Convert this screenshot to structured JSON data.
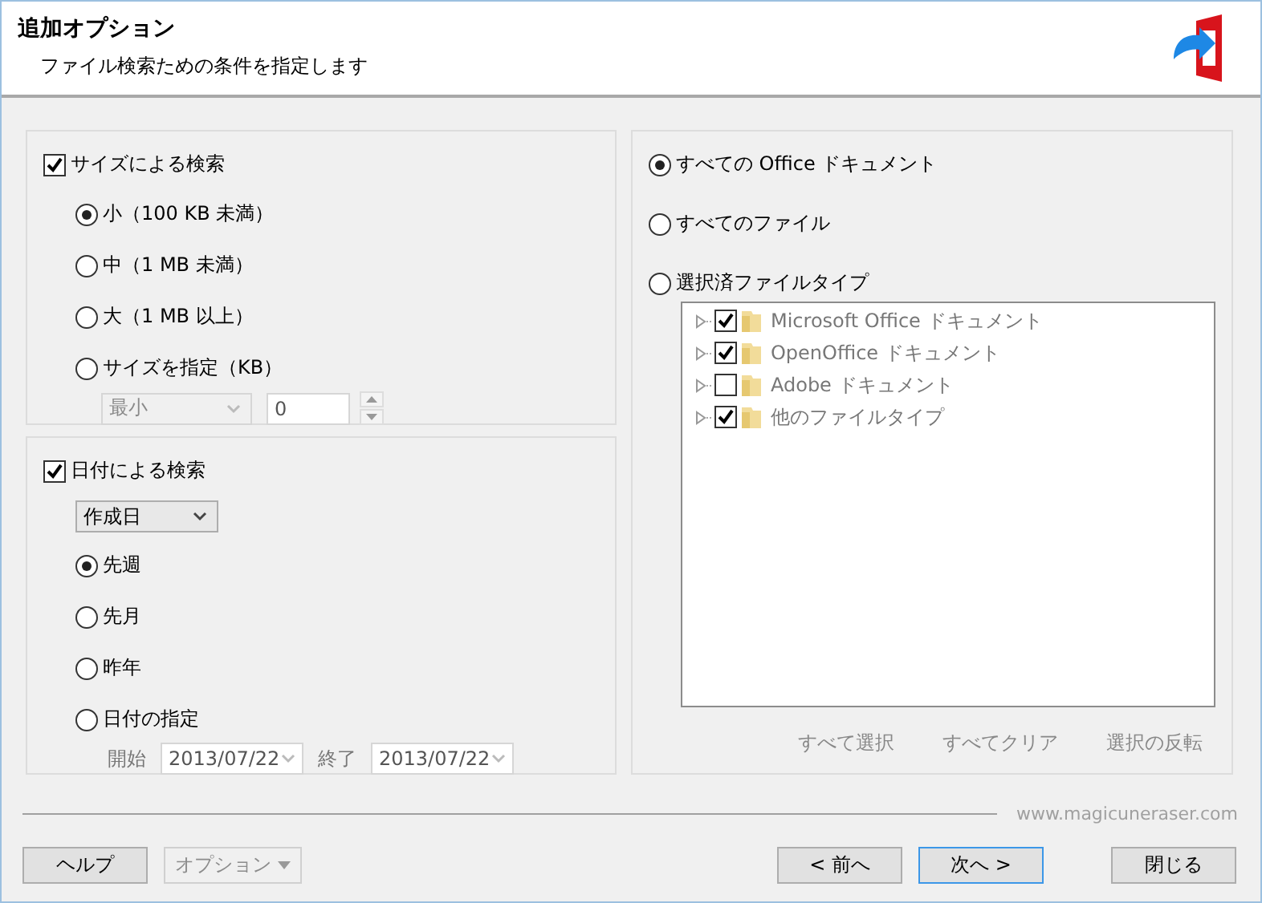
{
  "header": {
    "title": "追加オプション",
    "subtitle": "ファイル検索ための条件を指定します"
  },
  "size_group": {
    "label": "サイズによる検索",
    "checked": true,
    "options": [
      {
        "label": "小（100 KB 未満）",
        "selected": true
      },
      {
        "label": "中（1 MB 未満）",
        "selected": false
      },
      {
        "label": "大（1 MB 以上）",
        "selected": false
      },
      {
        "label": "サイズを指定（KB）",
        "selected": false
      }
    ],
    "min_select": {
      "value": "最小",
      "disabled": true
    },
    "size_input": {
      "value": "0",
      "disabled": true
    }
  },
  "date_group": {
    "label": "日付による検索",
    "checked": true,
    "date_type": "作成日",
    "options": [
      {
        "label": "先週",
        "selected": true
      },
      {
        "label": "先月",
        "selected": false
      },
      {
        "label": "昨年",
        "selected": false
      },
      {
        "label": "日付の指定",
        "selected": false
      }
    ],
    "range_disabled": true,
    "from_label": "開始",
    "from": "2013/07/22",
    "to_label": "終了",
    "to": "2013/07/22"
  },
  "file_types": {
    "options": [
      {
        "label": "すべての Office ドキュメント",
        "selected": true
      },
      {
        "label": "すべてのファイル",
        "selected": false
      },
      {
        "label": "選択済ファイルタイプ",
        "selected": false
      }
    ],
    "tree_disabled": true,
    "tree": [
      {
        "label": "Microsoft Office ドキュメント",
        "checked": true
      },
      {
        "label": "OpenOffice ドキュメント",
        "checked": true
      },
      {
        "label": "Adobe ドキュメント",
        "checked": false
      },
      {
        "label": "他のファイルタイプ",
        "checked": true
      }
    ],
    "actions": [
      "すべて選択",
      "すべてクリア",
      "選択の反転"
    ]
  },
  "footer": {
    "url": "www.magicuneraser.com",
    "buttons": [
      {
        "label": "ヘルプ",
        "kind": "plain",
        "disabled": false,
        "focused": false
      },
      {
        "label": "オプション",
        "kind": "dropdown",
        "disabled": true,
        "focused": false
      },
      {
        "label": "< 前へ",
        "kind": "plain",
        "disabled": false,
        "focused": false
      },
      {
        "label": "次へ >",
        "kind": "plain",
        "disabled": false,
        "focused": true
      },
      {
        "label": "閉じる",
        "kind": "plain",
        "disabled": false,
        "focused": false
      }
    ]
  }
}
